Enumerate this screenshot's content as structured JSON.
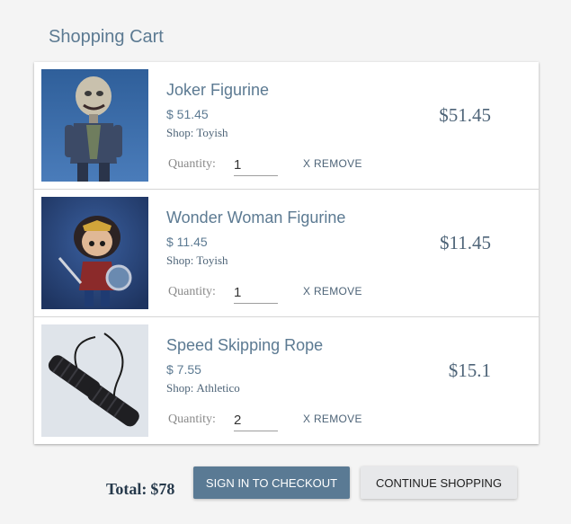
{
  "page": {
    "title": "Shopping Cart"
  },
  "cart": {
    "items": [
      {
        "name": "Joker Figurine",
        "unit_price": "$ 51.45",
        "shop_label": "Shop:",
        "shop_name": "Toyish",
        "quantity_label": "Quantity:",
        "quantity": "1",
        "remove_label": "X REMOVE",
        "line_total": "$51.45",
        "image_icon": "joker-figurine-photo"
      },
      {
        "name": "Wonder Woman Figurine",
        "unit_price": "$ 11.45",
        "shop_label": "Shop:",
        "shop_name": "Toyish",
        "quantity_label": "Quantity:",
        "quantity": "1",
        "remove_label": "X REMOVE",
        "line_total": "$11.45",
        "image_icon": "wonder-woman-figurine-photo"
      },
      {
        "name": "Speed Skipping Rope",
        "unit_price": "$ 7.55",
        "shop_label": "Shop:",
        "shop_name": "Athletico",
        "quantity_label": "Quantity:",
        "quantity": "2",
        "remove_label": "X REMOVE",
        "line_total": "$15.1",
        "image_icon": "skipping-rope-photo"
      }
    ]
  },
  "footer": {
    "total_label": "Total:",
    "total_value": "$78",
    "checkout_label": "SIGN IN TO CHECKOUT",
    "continue_label": "CONTINUE SHOPPING"
  },
  "colors": {
    "accent": "#5a7a94",
    "title_text": "#5c7a92",
    "background": "#f4f4f4"
  }
}
